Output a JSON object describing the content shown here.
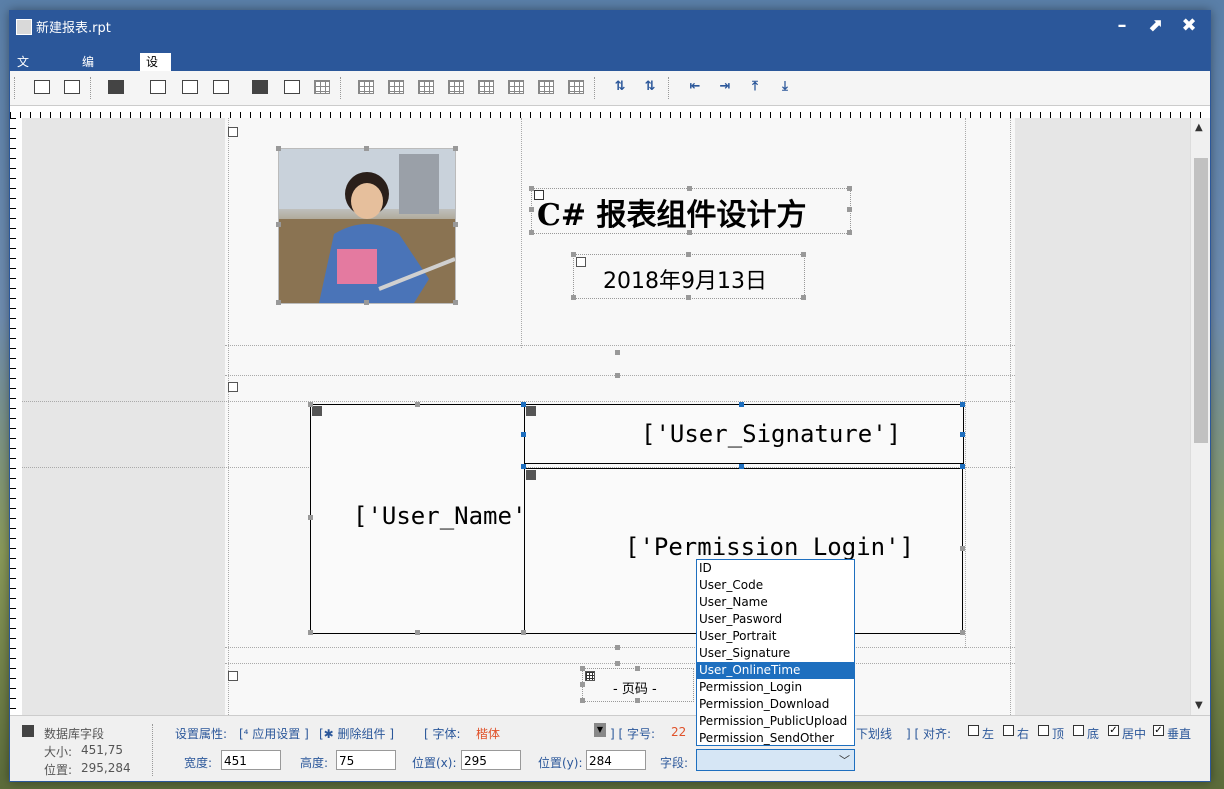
{
  "window": {
    "title": "新建报表.rpt"
  },
  "menu": [
    "文件(F)",
    "编辑(E)",
    "设计(D)"
  ],
  "design": {
    "report_title": "C# 报表组件设计方",
    "report_date": "2018年9月13日",
    "field_user_name": "['User_Name'",
    "field_user_signature": "['User_Signature']",
    "field_permission_login": "['Permission_Login']",
    "page_number": "- 页码 -"
  },
  "field_dropdown": {
    "options": [
      "ID",
      "User_Code",
      "User_Name",
      "User_Pasword",
      "User_Portrait",
      "User_Signature",
      "User_OnlineTime",
      "Permission_Login",
      "Permission_Download",
      "Permission_PublicUpload",
      "Permission_SendOther"
    ],
    "selected": "User_OnlineTime"
  },
  "status": {
    "component_type": "数据库字段",
    "size_label": "大小:",
    "size_value": "451,75",
    "pos_label": "位置:",
    "pos_value": "295,284",
    "set_props": "设置属性:",
    "apply": "[⁴ 应用设置 ]",
    "delete": "[✱ 删除组件 ]",
    "font_label": "[ 字体:",
    "font_value": "楷体",
    "fontsize_label": "] [ 字号:",
    "fontsize_value": "22",
    "underline_label": "下划线",
    "align_label": "] [ 对齐:",
    "align_left": "左",
    "align_right": "右",
    "align_top": "顶",
    "align_bottom": "底",
    "align_center": "居中",
    "align_vcenter": "垂直",
    "width_label": "宽度:",
    "width_value": "451",
    "height_label": "高度:",
    "height_value": "75",
    "x_label": "位置(x):",
    "x_value": "295",
    "y_label": "位置(y):",
    "y_value": "284",
    "field_label": "字段:"
  }
}
